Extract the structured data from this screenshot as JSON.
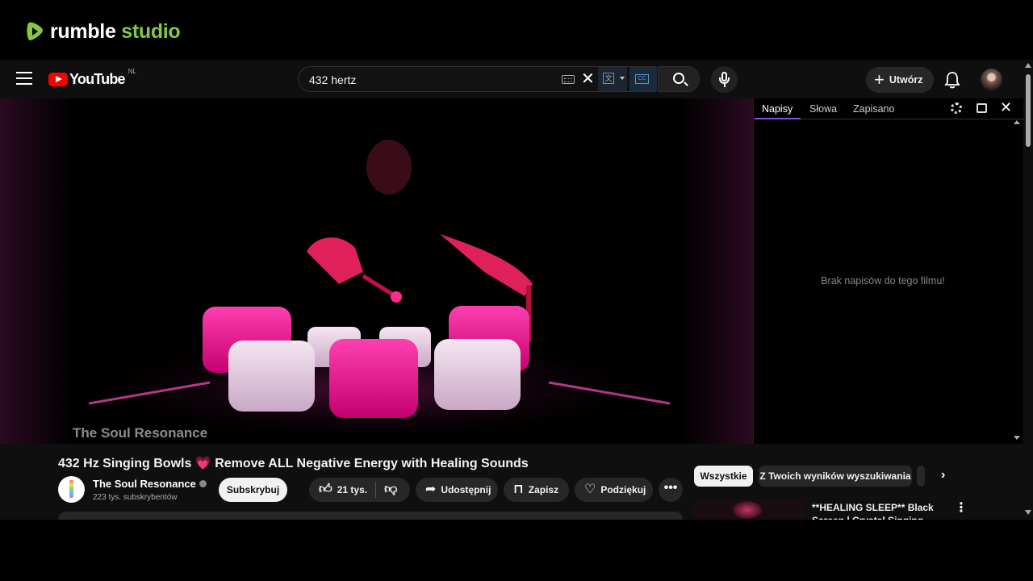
{
  "overlay": {
    "brand_part1": "rumble",
    "brand_part2": "studio",
    "brand_color": "#85c742"
  },
  "header": {
    "logo_text": "YouTube",
    "country_code": "NL",
    "search_value": "432 hertz",
    "create_label": "Utwórz",
    "icons": [
      "menu-icon",
      "keyboard-icon",
      "clear-icon",
      "translate-icon",
      "caption-search-icon",
      "search-icon",
      "mic-icon",
      "plus-icon",
      "bell-icon",
      "avatar"
    ]
  },
  "video": {
    "watermark": "The Soul Resonance"
  },
  "transcript_panel": {
    "tabs": [
      "Napisy",
      "Słowa",
      "Zapisano"
    ],
    "active_tab": "Napisy",
    "empty_message": "Brak napisów do tego filmu!",
    "accent": "#8a4fd6"
  },
  "details": {
    "title_before": "432 Hz Singing Bowls",
    "title_emoji": "💗",
    "title_after": "Remove ALL Negative Energy with Healing Sounds",
    "channel_name": "The Soul Resonance",
    "subscribers": "223 tys. subskrybentów",
    "subscribe_label": "Subskrybuj",
    "likes": "21 tys.",
    "share_label": "Udostępnij",
    "save_label": "Zapisz",
    "thanks_label": "Podziękuj",
    "more_label": "•••"
  },
  "sidebar": {
    "chips": [
      "Wszystkie",
      "Z Twoich wyników wyszukiwania"
    ],
    "recommendation_title": "**HEALING SLEEP** Black Screen | Crystal Singing Bowls"
  }
}
